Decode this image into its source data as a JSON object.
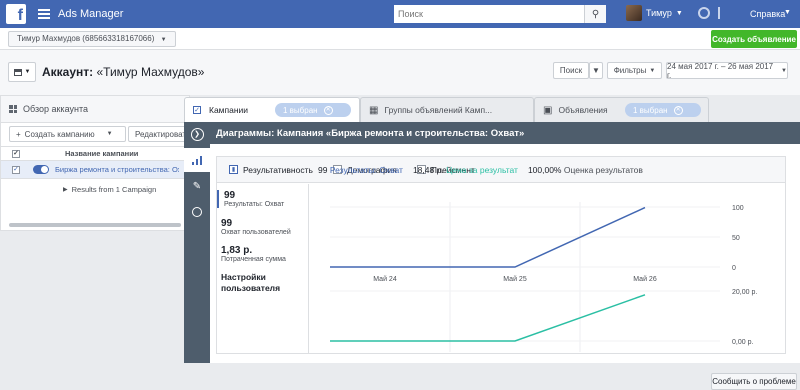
{
  "topbar": {
    "logo": "f",
    "app_title": "Ads Manager",
    "search_placeholder": "Поиск",
    "user_name": "Тимур",
    "help_label": "Справка"
  },
  "account_bar": {
    "account_selector": "Тимур Махмудов (685663318167066)",
    "create_ad_label": "Создать объявление"
  },
  "header": {
    "account_prefix": "Аккаунт:",
    "account_name": "«Тимур Махмудов»",
    "search_label": "Поиск",
    "filters_label": "Фильтры",
    "date_range": "24 мая 2017 г. – 26 мая 2017 г."
  },
  "left_panel": {
    "title": "Обзор аккаунта",
    "create_campaign_label": "Создать кампанию",
    "edit_label": "Редактировать",
    "column_header": "Название кампании",
    "campaign_name": "Биржа ремонта и строительства: Охв",
    "results_row": "Results from 1 Campaign"
  },
  "tabs": [
    {
      "label": "Кампании",
      "pill": "1 выбран"
    },
    {
      "label": "Группы объявлений Камп..."
    },
    {
      "label": "Объявления",
      "pill": "1 выбран"
    }
  ],
  "chart_panel": {
    "title": "Диаграммы: Кампания «Биржа ремонта и строительства: Охват»",
    "chart_tabs": [
      "Результативность",
      "Демография",
      "Плейсмент"
    ],
    "metrics": [
      {
        "value": "99",
        "label": "Результаты: Охват"
      },
      {
        "value": "99",
        "label": "Охват пользователей"
      },
      {
        "value": "1,83 р.",
        "label": "Потраченная сумма"
      }
    ],
    "settings_label": "Настройки пользователя",
    "summary": {
      "results_value": "99",
      "results_label": "Результаты: Охват",
      "cost_value": "18,48 р.",
      "cost_label": "Цена за результат",
      "rank_value": "100,00%",
      "rank_label": "Оценка результатов"
    }
  },
  "chart_data": [
    {
      "type": "line",
      "categories": [
        "Май 24",
        "Май 25",
        "Май 26"
      ],
      "series": [
        {
          "name": "Результаты: Охват",
          "values": [
            0,
            0,
            99
          ],
          "color": "#4267b2"
        }
      ],
      "ytick_labels": [
        "100",
        "50",
        "0"
      ],
      "ylim": [
        0,
        100
      ]
    },
    {
      "type": "line",
      "categories": [
        "Май 24",
        "Май 25",
        "Май 26"
      ],
      "series": [
        {
          "name": "Цена за результат",
          "values": [
            0,
            0,
            18.48
          ],
          "color": "#2bbfa4"
        }
      ],
      "ytick_labels": [
        "20,00 р.",
        "0,00 р."
      ],
      "ylim": [
        0,
        20
      ]
    }
  ],
  "footer": {
    "report_label": "Сообщить о проблеме"
  }
}
